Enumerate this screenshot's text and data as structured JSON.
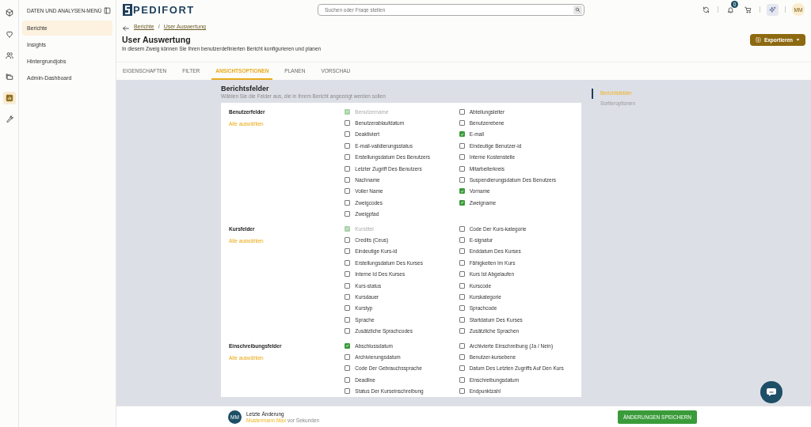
{
  "sidebar": {
    "title": "DATEN UND ANALYSEN-MENÜ",
    "items": [
      {
        "label": "Berichte",
        "selected": true
      },
      {
        "label": "Insights",
        "selected": false
      },
      {
        "label": "Hintergrundjobs",
        "selected": false
      },
      {
        "label": "Admin-Dashboard",
        "selected": false
      }
    ]
  },
  "rail": [
    {
      "kind": "cube",
      "selected": false
    },
    {
      "kind": "heart",
      "selected": false
    },
    {
      "kind": "users",
      "selected": false
    },
    {
      "kind": "folders",
      "selected": false
    },
    {
      "kind": "chart",
      "selected": true
    },
    {
      "kind": "tools",
      "selected": false
    }
  ],
  "header": {
    "logo": "PEDIFORT",
    "search": {
      "placeholder": "Suchen oder Frage stellen"
    },
    "notification_count": "0",
    "avatar": "MM"
  },
  "breadcrumb": [
    "Berichte",
    "User Auswertung"
  ],
  "breadcrumb_separator": "/",
  "page": {
    "title": "User Auswertung",
    "subtitle": "In diesem Zweig können Sie Ihren benutzerdefinierten Bericht konfigurieren und planen",
    "export_button": "Exportieren"
  },
  "tabs": [
    {
      "label": "EIGENSCHAFTEN",
      "selected": false
    },
    {
      "label": "FILTER",
      "selected": false
    },
    {
      "label": "ANSICHTSOPTIONEN",
      "selected": true
    },
    {
      "label": "PLANEN",
      "selected": false
    },
    {
      "label": "VORSCHAU",
      "selected": false
    }
  ],
  "panel": {
    "title": "Berichtsfelder",
    "subtitle": "Wählen Sie die Felder aus, die in Ihrem Bericht angezeigt werden sollen"
  },
  "sections": [
    {
      "title": "Benutzerfelder",
      "select_all": "Alle auswählen",
      "left": [
        {
          "label": "Benutzername",
          "checked": true,
          "disabled": true
        },
        {
          "label": "Benutzerablaufdatum",
          "checked": false,
          "disabled": false
        },
        {
          "label": "Deaktiviert",
          "checked": false,
          "disabled": false
        },
        {
          "label": "E-mail-validierungsstatus",
          "checked": false,
          "disabled": false
        },
        {
          "label": "Erstellungsdatum Des Benutzers",
          "checked": false,
          "disabled": false
        },
        {
          "label": "Letzter Zugriff Des Benutzers",
          "checked": false,
          "disabled": false
        },
        {
          "label": "Nachname",
          "checked": false,
          "disabled": false
        },
        {
          "label": "Voller Name",
          "checked": false,
          "disabled": false
        },
        {
          "label": "Zweigcodes",
          "checked": false,
          "disabled": false
        },
        {
          "label": "Zweigpfad",
          "checked": false,
          "disabled": false
        }
      ],
      "right": [
        {
          "label": "Abteilungsleiter",
          "checked": false,
          "disabled": false
        },
        {
          "label": "Benutzerebene",
          "checked": false,
          "disabled": false
        },
        {
          "label": "E-mail",
          "checked": true,
          "disabled": false
        },
        {
          "label": "Eindeutige Benutzer-id",
          "checked": false,
          "disabled": false
        },
        {
          "label": "Interne Kostenstelle",
          "checked": false,
          "disabled": false
        },
        {
          "label": "Mitarbeiterkreis",
          "checked": false,
          "disabled": false
        },
        {
          "label": "Suspendierungsdatum Des Benutzers",
          "checked": false,
          "disabled": false
        },
        {
          "label": "Vorname",
          "checked": true,
          "disabled": false
        },
        {
          "label": "Zweigname",
          "checked": true,
          "disabled": false
        }
      ]
    },
    {
      "title": "Kursfelder",
      "select_all": "Alle auswählen",
      "left": [
        {
          "label": "Kurstitel",
          "checked": true,
          "disabled": true
        },
        {
          "label": "Credits (Ceus)",
          "checked": false,
          "disabled": false
        },
        {
          "label": "Eindeutige Kurs-id",
          "checked": false,
          "disabled": false
        },
        {
          "label": "Erstellungsdatum Des Kurses",
          "checked": false,
          "disabled": false
        },
        {
          "label": "Interne Id Des Kurses",
          "checked": false,
          "disabled": false
        },
        {
          "label": "Kurs-status",
          "checked": false,
          "disabled": false
        },
        {
          "label": "Kursdauer",
          "checked": false,
          "disabled": false
        },
        {
          "label": "Kurstyp",
          "checked": false,
          "disabled": false
        },
        {
          "label": "Sprache",
          "checked": false,
          "disabled": false
        },
        {
          "label": "Zusätzliche Sprachcodes",
          "checked": false,
          "disabled": false
        }
      ],
      "right": [
        {
          "label": "Code Der Kurs-kategorie",
          "checked": false,
          "disabled": false
        },
        {
          "label": "E-signatur",
          "checked": false,
          "disabled": false
        },
        {
          "label": "Enddatum Des Kurses",
          "checked": false,
          "disabled": false
        },
        {
          "label": "Fähigkeiten Im Kurs",
          "checked": false,
          "disabled": false
        },
        {
          "label": "Kurs Ist Abgelaufen",
          "checked": false,
          "disabled": false
        },
        {
          "label": "Kurscode",
          "checked": false,
          "disabled": false
        },
        {
          "label": "Kurskategorie",
          "checked": false,
          "disabled": false
        },
        {
          "label": "Sprachcode",
          "checked": false,
          "disabled": false
        },
        {
          "label": "Startdatum Des Kurses",
          "checked": false,
          "disabled": false
        },
        {
          "label": "Zusätzliche Sprachen",
          "checked": false,
          "disabled": false
        }
      ]
    },
    {
      "title": "Einschreibungsfelder",
      "select_all": "Alle auswählen",
      "left": [
        {
          "label": "Abschlussdatum",
          "checked": true,
          "disabled": false
        },
        {
          "label": "Archivierungsdatum",
          "checked": false,
          "disabled": false
        },
        {
          "label": "Code Der Gebrauchssprache",
          "checked": false,
          "disabled": false
        },
        {
          "label": "Deadline",
          "checked": false,
          "disabled": false
        },
        {
          "label": "Status Der Kurseinschreibung",
          "checked": false,
          "disabled": false
        }
      ],
      "right": [
        {
          "label": "Archivierte Einschreibung (Ja / Nein)",
          "checked": false,
          "disabled": false
        },
        {
          "label": "Benutzer-kursebene",
          "checked": false,
          "disabled": false
        },
        {
          "label": "Datum Des Letzten Zugriffs Auf Den Kurs",
          "checked": false,
          "disabled": false
        },
        {
          "label": "Einschreibungsdatum",
          "checked": false,
          "disabled": false
        },
        {
          "label": "Endpunktzahl",
          "checked": false,
          "disabled": false
        }
      ]
    }
  ],
  "toc": [
    {
      "label": "Berichtsfelder",
      "selected": true
    },
    {
      "label": "Sortieroptionen",
      "selected": false
    }
  ],
  "footer": {
    "avatar": "MM",
    "title": "Letzte Änderung",
    "user": "Mustermann Max",
    "time": "vor Sekunden",
    "save_button": "ÄNDERUNGEN SPEICHERN"
  }
}
